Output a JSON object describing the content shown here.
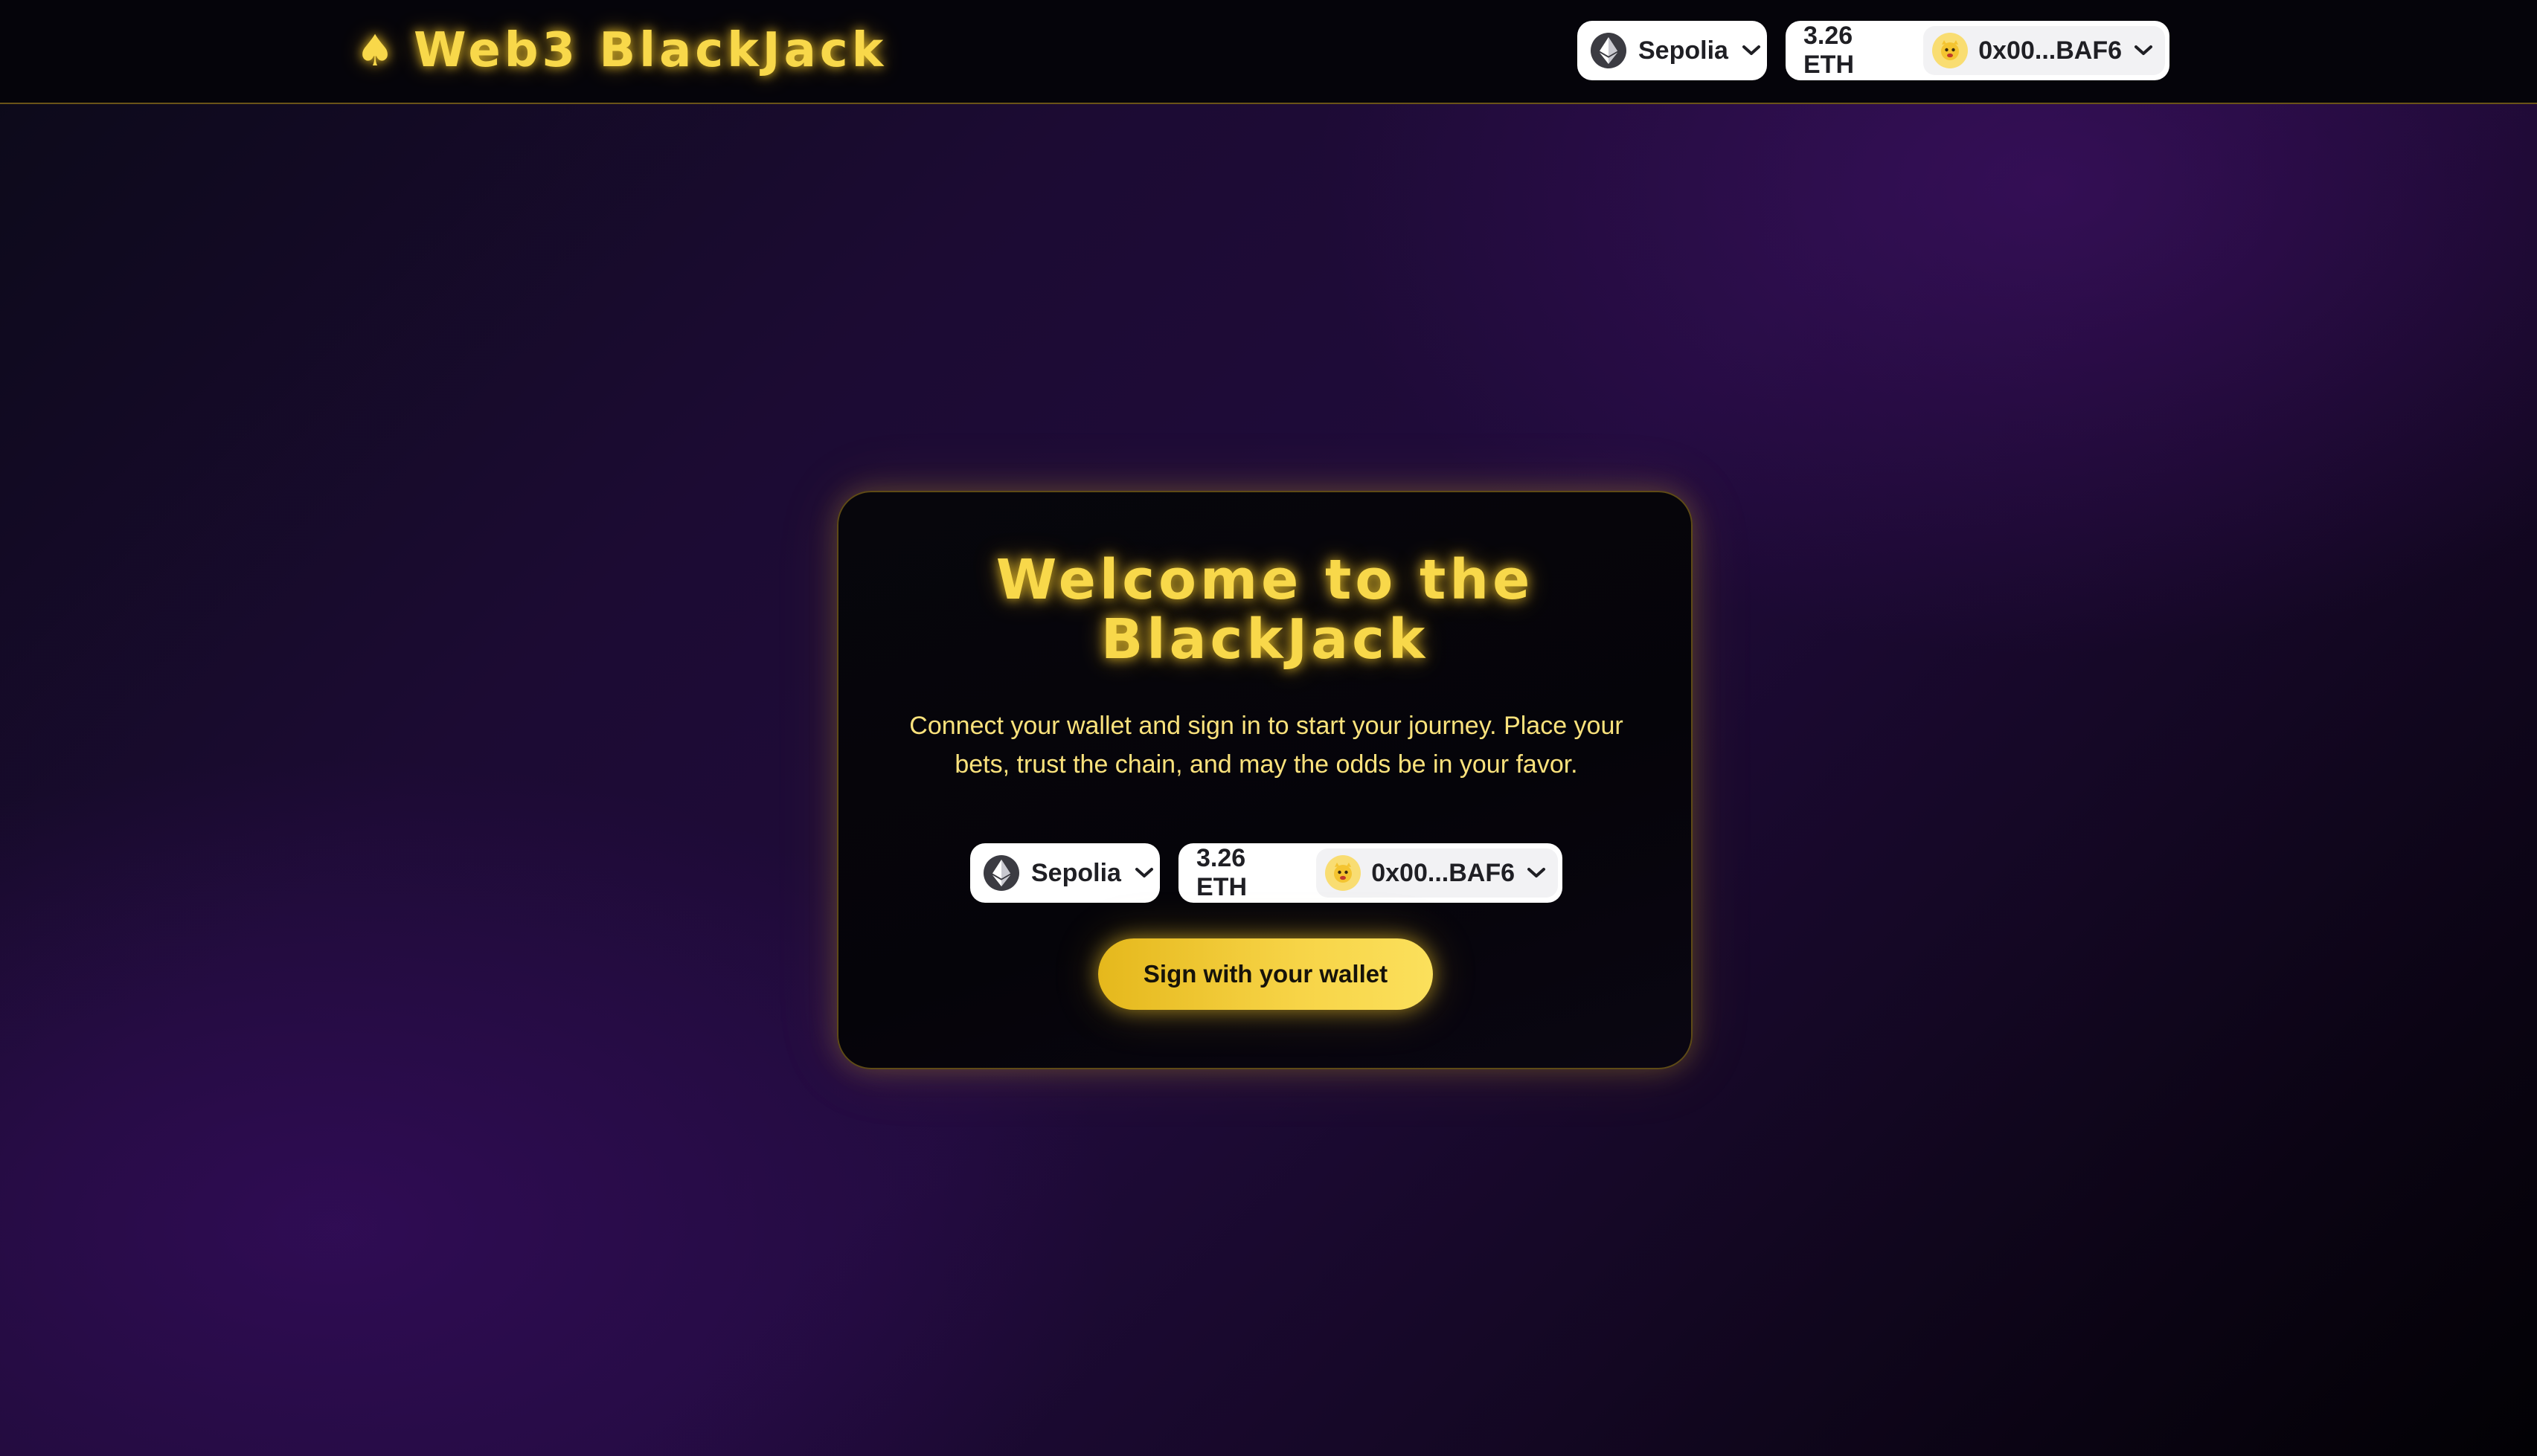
{
  "header": {
    "brand_icon": "♠",
    "brand_title": "Web3 BlackJack",
    "network": {
      "icon": "ethereum-icon",
      "label": "Sepolia"
    },
    "account": {
      "balance": "3.26 ETH",
      "address": "0x00...BAF6",
      "avatar": "avatar-emoji"
    }
  },
  "card": {
    "title_line1": "Welcome to the",
    "title_line2": "BlackJack",
    "description_line1": "Connect your wallet and sign in to start your journey. Place your",
    "description_line2": "bets, trust the chain, and may the odds be in your favor.",
    "network": {
      "label": "Sepolia"
    },
    "account": {
      "balance": "3.26 ETH",
      "address": "0x00...BAF6"
    },
    "sign_button_label": "Sign with your wallet"
  },
  "colors": {
    "accent_gold": "#f8d84a",
    "header_bg": "#05040a",
    "card_bg": "#07060c",
    "pill_bg": "#ffffff"
  }
}
